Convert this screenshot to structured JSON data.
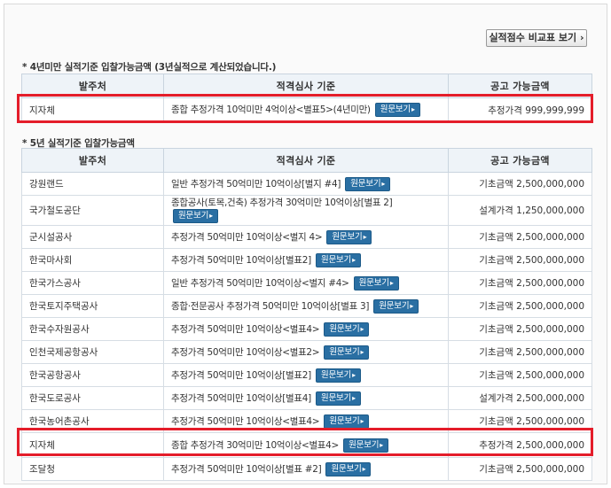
{
  "top_button": "실적점수 비교표 보기",
  "section1": {
    "title": "* 4년미만 실적기준 입찰가능금액 (3년실적으로 계산되었습니다.)",
    "headers": [
      "발주처",
      "적격심사 기준",
      "공고 가능금액"
    ],
    "rows": [
      {
        "org": "지자체",
        "criteria": "종합 추정가격 10억미만 4억이상<별표5>(4년미만)",
        "button": "원문보기",
        "amount": "추정가격 999,999,999"
      }
    ]
  },
  "section2": {
    "title": "* 5년 실적기준 입찰가능금액",
    "headers": [
      "발주처",
      "적격심사 기준",
      "공고 가능금액"
    ],
    "rows": [
      {
        "org": "강원랜드",
        "criteria": "일반 추정가격 50억미만 10억이상[별지 #4]",
        "button": "원문보기",
        "amount": "기초금액 2,500,000,000"
      },
      {
        "org": "국가철도공단",
        "criteria": "종합공사(토목,건축) 추정가격 30억미만 10억이상[별표 2]",
        "button": "원문보기",
        "amount": "설계가격 1,250,000,000"
      },
      {
        "org": "군시설공사",
        "criteria": "추정가격 50억미만 10억이상<별지 4>",
        "button": "원문보기",
        "amount": "기초금액 2,500,000,000"
      },
      {
        "org": "한국마사회",
        "criteria": "추정가격 50억미만 10억이상[별표2]",
        "button": "원문보기",
        "amount": "기초금액 2,500,000,000"
      },
      {
        "org": "한국가스공사",
        "criteria": "일반 추정가격 50억미만 10억이상<별지 #4>",
        "button": "원문보기",
        "amount": "기초금액 2,500,000,000"
      },
      {
        "org": "한국토지주택공사",
        "criteria": "종합·전문공사 추정가격 50억미만 10억이상[별표 3]",
        "button": "원문보기",
        "amount": "기초금액 2,500,000,000"
      },
      {
        "org": "한국수자원공사",
        "criteria": "추정가격 50억미만 10억이상<별표4>",
        "button": "원문보기",
        "amount": "기초금액 2,500,000,000"
      },
      {
        "org": "인천국제공항공사",
        "criteria": "추정가격 50억미만 10억이상<별표2>",
        "button": "원문보기",
        "amount": "기초금액 2,500,000,000"
      },
      {
        "org": "한국공항공사",
        "criteria": "추정가격 50억미만 10억이상[별표2]",
        "button": "원문보기",
        "amount": "기초금액 2,500,000,000"
      },
      {
        "org": "한국도로공사",
        "criteria": "추정가격 50억미만 10억이상[별표4]",
        "button": "원문보기",
        "amount": "설계가격 2,500,000,000"
      },
      {
        "org": "한국농어촌공사",
        "criteria": "추정가격 50억미만 10억이상<별표4>",
        "button": "원문보기",
        "amount": "기초금액 2,500,000,000"
      },
      {
        "org": "지자체",
        "criteria": "종합 추정가격 30억미만 10억이상<별표4>",
        "button": "원문보기",
        "amount": "추정가격 2,500,000,000"
      },
      {
        "org": "조달청",
        "criteria": "추정가격 50억미만 10억이상[별표 #2]",
        "button": "원문보기",
        "amount": "기초금액 2,500,000,000"
      }
    ]
  },
  "colors": {
    "highlight": "#e41d2a",
    "button": "#2a6fa3",
    "header_bg": "#eef3f8"
  }
}
